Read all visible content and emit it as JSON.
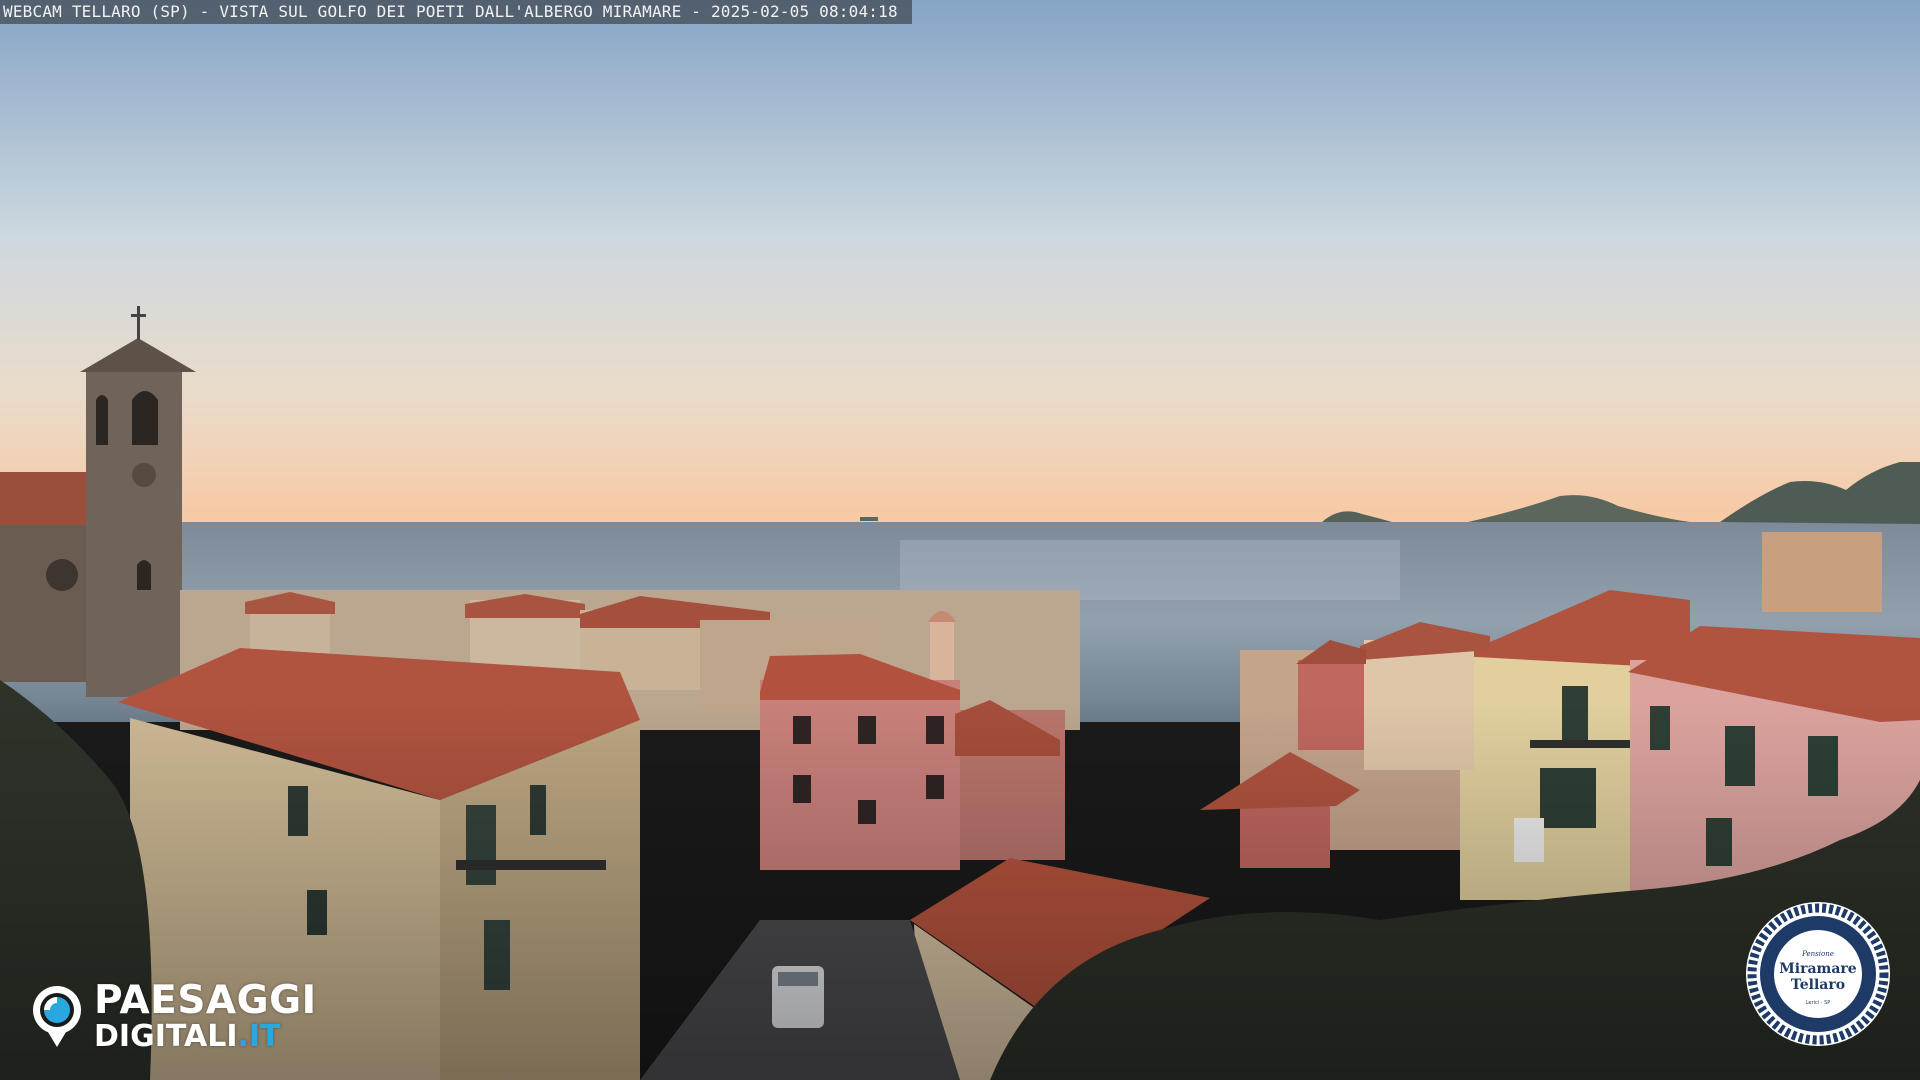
{
  "caption": {
    "text": "WEBCAM TELLARO (SP) - VISTA SUL GOLFO DEI POETI DALL'ALBERGO MIRAMARE - 2025-02-05 08:04:18"
  },
  "watermark": {
    "word1": "PAESAGGI",
    "word2": "DIGITALI",
    "tld": ".IT",
    "icon": "eye-icon",
    "accent_color": "#29a8e0"
  },
  "badge": {
    "small": "Pensione",
    "line1": "Miramare",
    "line2": "Tellaro",
    "footer": "Lerici - SP",
    "rope_color": "#1e3a66"
  },
  "palette": {
    "sky_top": "#8aa7c7",
    "sky_mid": "#d7dfe2",
    "sky_horizon": "#f7c9a3",
    "sea": "#8c9aa8",
    "roof": "#b0533f"
  }
}
